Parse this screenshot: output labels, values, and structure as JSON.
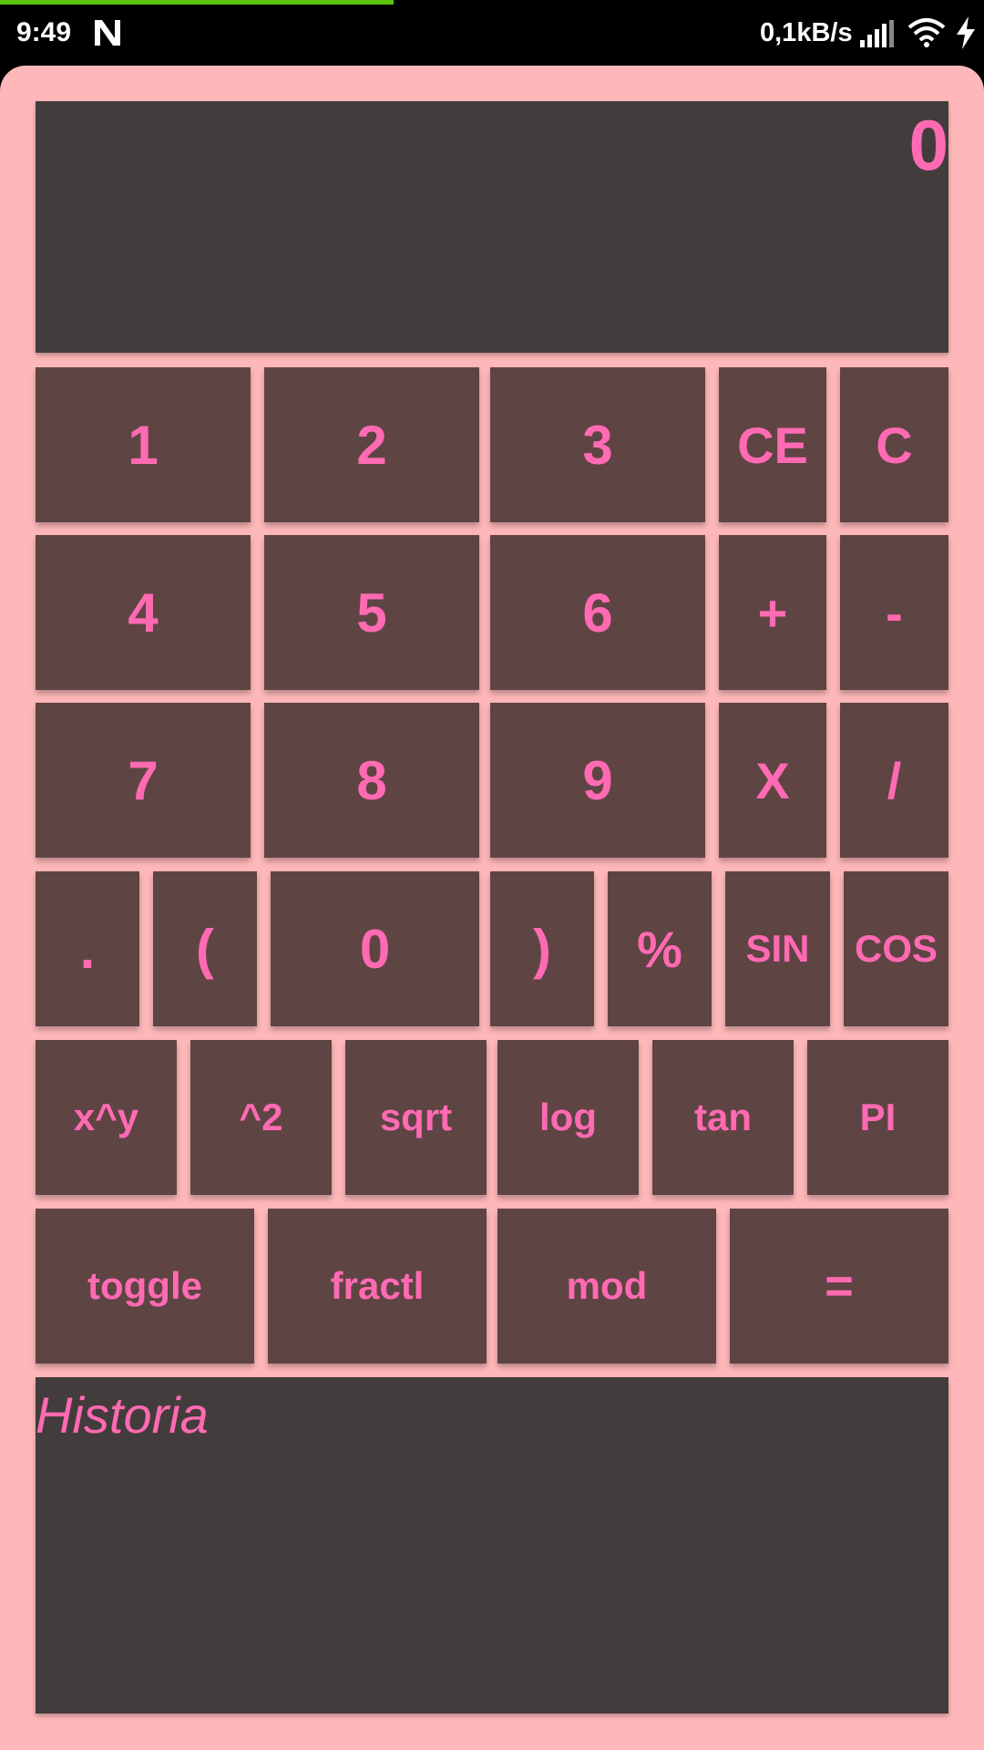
{
  "status_bar": {
    "time": "9:49",
    "network_speed": "0,1kB/s",
    "progress_fraction": 0.4,
    "progress_color": "#5ac40a",
    "icons": [
      "n-notification-icon",
      "signal-icon",
      "wifi-icon",
      "charging-icon"
    ]
  },
  "theme": {
    "background": "#ffb8ba",
    "panel": "#433c3c",
    "button": "#5f4444",
    "accent": "#ff6ab2"
  },
  "display": {
    "value": "0"
  },
  "keys": {
    "row1": [
      "1",
      "2",
      "3",
      "CE",
      "C"
    ],
    "row2": [
      "4",
      "5",
      "6",
      "+",
      "-"
    ],
    "row3": [
      "7",
      "8",
      "9",
      "X",
      "/"
    ],
    "row4": [
      ".",
      "(",
      "0",
      ")",
      "%",
      "SIN",
      "COS"
    ],
    "row5": [
      "x^y",
      "^2",
      "sqrt",
      "log",
      "tan",
      "PI"
    ],
    "row6": [
      "toggle",
      "fractl",
      "mod",
      "="
    ]
  },
  "history": {
    "label": "Historia"
  }
}
